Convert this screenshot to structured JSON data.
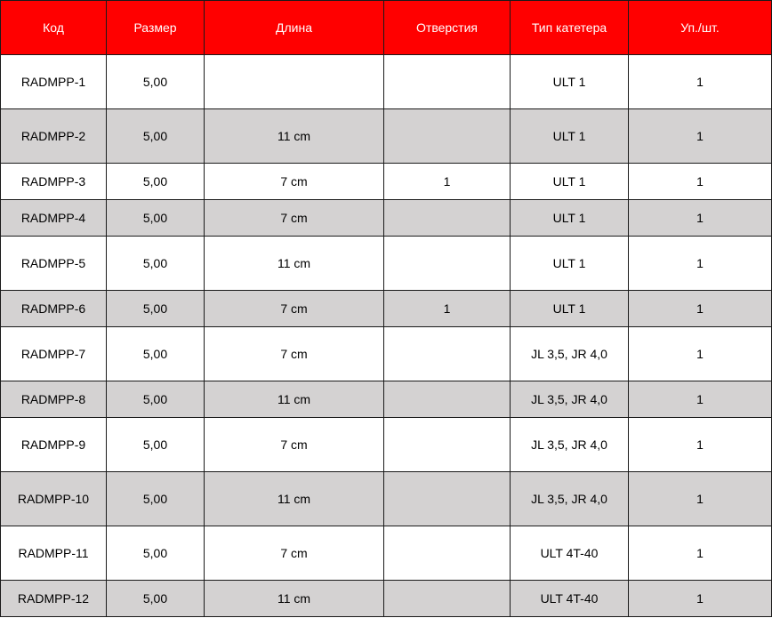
{
  "headers": [
    "Код",
    "Размер",
    "Длина",
    "Отверстия",
    "Тип катетера",
    "Уп./шт."
  ],
  "rows": [
    [
      "RADMPP-1",
      "5,00",
      "",
      "",
      "ULT 1",
      "1"
    ],
    [
      "RADMPP-2",
      "5,00",
      "11 cm",
      "",
      "ULT 1",
      "1"
    ],
    [
      "RADMPP-3",
      "5,00",
      "7 cm",
      "1",
      "ULT 1",
      "1"
    ],
    [
      "RADMPP-4",
      "5,00",
      "7 cm",
      "",
      "ULT 1",
      "1"
    ],
    [
      "RADMPP-5",
      "5,00",
      "11 cm",
      "",
      "ULT 1",
      "1"
    ],
    [
      "RADMPP-6",
      "5,00",
      "7 cm",
      "1",
      "ULT 1",
      "1"
    ],
    [
      "RADMPP-7",
      "5,00",
      "7 cm",
      "",
      "JL 3,5, JR 4,0",
      "1"
    ],
    [
      "RADMPP-8",
      "5,00",
      "11 cm",
      "",
      "JL 3,5, JR 4,0",
      "1"
    ],
    [
      "RADMPP-9",
      "5,00",
      "7 cm",
      "",
      "JL 3,5, JR 4,0",
      "1"
    ],
    [
      "RADMPP-10",
      "5,00",
      "11 cm",
      "",
      "JL 3,5, JR 4,0",
      "1"
    ],
    [
      "RADMPP-11",
      "5,00",
      "7 cm",
      "",
      "ULT 4T-40",
      "1"
    ],
    [
      "RADMPP-12",
      "5,00",
      "11 cm",
      "",
      "ULT 4T-40",
      "1"
    ]
  ],
  "colors": {
    "header_background": "#ff0000",
    "header_text": "#ffffff",
    "shaded_row": "#d4d2d2",
    "border": "#1a1a1a"
  }
}
